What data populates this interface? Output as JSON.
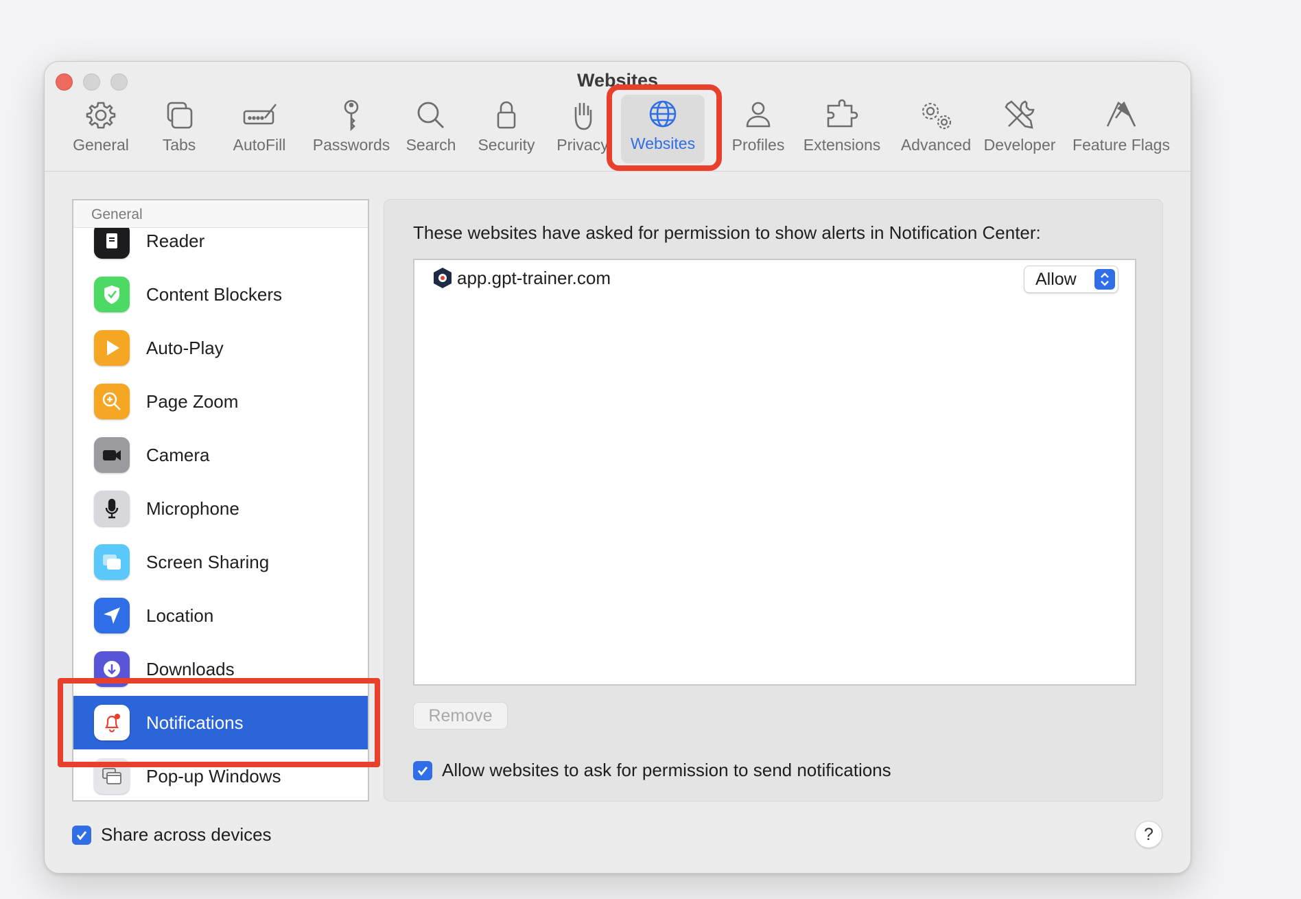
{
  "window": {
    "title": "Websites"
  },
  "toolbar": {
    "items": [
      {
        "label": "General",
        "icon": "gear-icon"
      },
      {
        "label": "Tabs",
        "icon": "tabs-icon"
      },
      {
        "label": "AutoFill",
        "icon": "pencil-field-icon"
      },
      {
        "label": "Passwords",
        "icon": "key-icon"
      },
      {
        "label": "Search",
        "icon": "magnifier-icon"
      },
      {
        "label": "Security",
        "icon": "lock-icon"
      },
      {
        "label": "Privacy",
        "icon": "hand-icon"
      },
      {
        "label": "Websites",
        "icon": "globe-icon",
        "selected": true
      },
      {
        "label": "Profiles",
        "icon": "person-icon"
      },
      {
        "label": "Extensions",
        "icon": "puzzle-icon"
      },
      {
        "label": "Advanced",
        "icon": "gears-icon"
      },
      {
        "label": "Developer",
        "icon": "tools-icon"
      },
      {
        "label": "Feature Flags",
        "icon": "flags-icon"
      }
    ]
  },
  "sidebar": {
    "header": "General",
    "items": [
      {
        "label": "Reader",
        "icon": "reader-icon",
        "color": "#1c1c1e"
      },
      {
        "label": "Content Blockers",
        "icon": "shield-check-icon",
        "color": "#4cd964"
      },
      {
        "label": "Auto-Play",
        "icon": "play-icon",
        "color": "#f5a623"
      },
      {
        "label": "Page Zoom",
        "icon": "zoom-icon",
        "color": "#f5a623"
      },
      {
        "label": "Camera",
        "icon": "camera-icon",
        "color": "#8e8e93"
      },
      {
        "label": "Microphone",
        "icon": "microphone-icon",
        "color": "#c7c7cc"
      },
      {
        "label": "Screen Sharing",
        "icon": "screen-sharing-icon",
        "color": "#5ac8fa"
      },
      {
        "label": "Location",
        "icon": "location-arrow-icon",
        "color": "#2f6ee6"
      },
      {
        "label": "Downloads",
        "icon": "download-icon",
        "color": "#5856d6"
      },
      {
        "label": "Notifications",
        "icon": "bell-icon",
        "color": "#ffffff",
        "selected": true
      },
      {
        "label": "Pop-up Windows",
        "icon": "popup-windows-icon",
        "color": "#e5e5ea"
      }
    ]
  },
  "main": {
    "description": "These websites have asked for permission to show alerts in Notification Center:",
    "sites": [
      {
        "name": "app.gpt-trainer.com",
        "permission": "Allow"
      }
    ],
    "remove_label": "Remove",
    "allow_ask_label": "Allow websites to ask for permission to send notifications",
    "allow_ask_checked": true
  },
  "footer": {
    "share_label": "Share across devices",
    "share_checked": true,
    "help_label": "?"
  },
  "colors": {
    "accent": "#2f6ee6",
    "selection": "#2c65d9",
    "highlight": "#e8402a",
    "close": "#ed6a5e"
  }
}
